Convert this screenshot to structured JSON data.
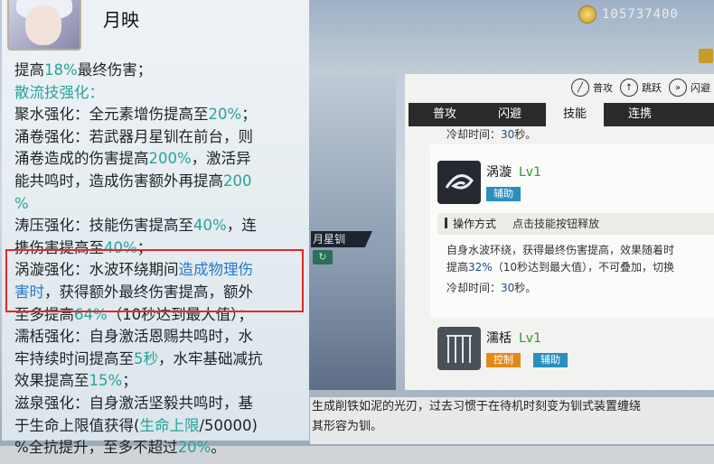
{
  "currency": {
    "amount": "105737400"
  },
  "controls": [
    {
      "icon": "sword-icon",
      "label": "普攻"
    },
    {
      "icon": "jump-icon",
      "label": "跳跃"
    },
    {
      "icon": "dodge-icon",
      "label": "闪避"
    }
  ],
  "tabs": [
    "普攻",
    "闪避",
    "技能",
    "连携"
  ],
  "active_tab": "技能",
  "tag_label": "月星钏",
  "cooldown_top": {
    "label": "冷却时间：",
    "num": "30",
    "unit": "秒。"
  },
  "skill1": {
    "name": "涡漩",
    "level": "Lv1",
    "badge": "辅助"
  },
  "op_row": {
    "label": "操作方式",
    "value": "点击技能按钮释放"
  },
  "skill1_desc": {
    "l1": "自身水波环绕，获得最终伤害提高，效果随着时",
    "l2a": "提高",
    "l2num": "32%",
    "l2b": "（10秒达到最大值），不可叠加，切换",
    "cd_label": "冷却时间：",
    "cd_num": "30",
    "cd_unit": "秒。"
  },
  "skill2": {
    "name": "濡栝",
    "level": "Lv1",
    "badge1": "控制",
    "badge2": "辅助"
  },
  "bottom_text": {
    "l1": "生成削铁如泥的光刃，过去习惯于在待机时刻变为钏式装置缠绕",
    "l2": "其形容为钏。"
  },
  "tooltip": {
    "name": "月映",
    "lines": {
      "a1": "提高",
      "a2": "18%",
      "a3": "最终伤害；",
      "b": "散流技强化：",
      "c1": "聚水强化：全元素增伤提高至",
      "c2": "20%",
      "c3": "；",
      "d": "涌卷强化：若武器月星钏在前台，则",
      "e1": "涌卷造成的伤害提高",
      "e2": "200%",
      "e3": "，激活异",
      "f1": "能共鸣时，造成伤害额外再提高",
      "f2": "200",
      "g": "%",
      "h1": "涛压强化：技能伤害提高至",
      "h2": "40%",
      "h3": "，连",
      "i1": "携伤害提高至",
      "i2": "40%",
      "i3": "；",
      "j1": "涡漩强化：水波环绕期间",
      "j2": "造成物理伤",
      "k1": "害时",
      "k2": "，获得额外最终伤害提高，额外",
      "l1": "至多提高",
      "l2": "64%",
      "l3": "（10秒达到最大值）；",
      "m": "濡栝强化：自身激活恩赐共鸣时，水",
      "n1": "牢持续时间提高至",
      "n2": "5秒",
      "n3": "，水牢基础减抗",
      "o1": "效果提高至",
      "o2": "15%",
      "o3": "；",
      "p": "滋泉强化：自身激活坚毅共鸣时，基",
      "q1": "于生命上限值获得(",
      "q2": "生命上限",
      "q3": "/50000)",
      "r1": "%全抗提升，至多不超过",
      "r2": "20%",
      "r3": "。"
    }
  },
  "colors": {
    "teal": "#27a39a",
    "blue": "#2979c9",
    "highlight_box": "#e22a2a",
    "level_green": "#2e9a2e"
  }
}
